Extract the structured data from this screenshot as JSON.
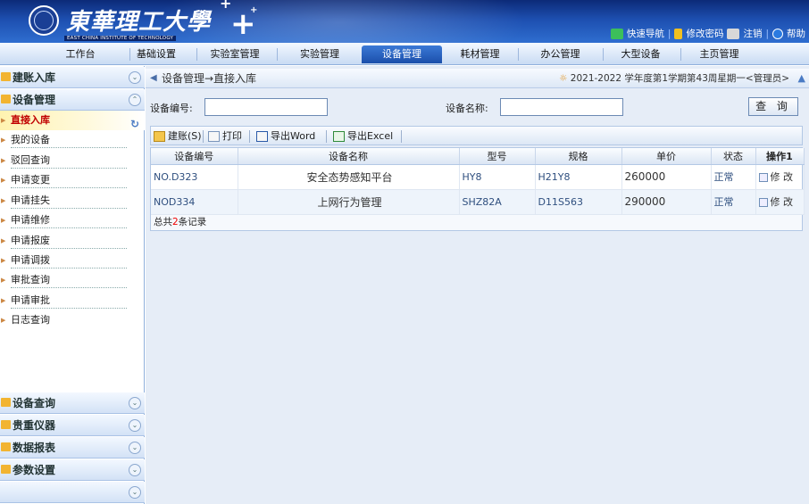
{
  "header": {
    "logo_cn": "東華理工大學",
    "logo_en": "EAST CHINA INSTITUTE OF TECHNOLOGY",
    "links": [
      {
        "icon": "quick-nav-icon",
        "label": "快速导航"
      },
      {
        "icon": "lock-icon",
        "label": "修改密码"
      },
      {
        "icon": "logout-icon",
        "label": "注销"
      },
      {
        "icon": "help-icon",
        "label": "帮助"
      }
    ]
  },
  "nav": {
    "tabs": [
      "工作台",
      "基础设置",
      "实验室管理",
      "实验管理",
      "设备管理",
      "耗材管理",
      "办公管理",
      "大型设备",
      "主页管理"
    ],
    "active": "设备管理"
  },
  "sidebar": {
    "top_sections": [
      {
        "label": "建账入库",
        "toggle": "⌄"
      },
      {
        "label": "设备管理",
        "toggle": "⌃"
      }
    ],
    "items": [
      "直接入库",
      "我的设备",
      "驳回查询",
      "申请变更",
      "申请挂失",
      "申请维修",
      "申请报废",
      "申请调拨",
      "审批查询",
      "申请审批",
      "日志查询"
    ],
    "active_item": "直接入库",
    "bottom_sections": [
      "设备查询",
      "贵重仪器",
      "数据报表",
      "参数设置",
      ""
    ]
  },
  "breadcrumb": {
    "path": "设备管理→直接入库",
    "info": "2021-2022 学年度第1学期第43周星期一<管理员>"
  },
  "search": {
    "code_label": "设备编号:",
    "code_value": "",
    "name_label": "设备名称:",
    "name_value": "",
    "query_button": "查 询"
  },
  "toolbar": {
    "create": "建账(S)",
    "print": "打印",
    "export_word": "导出Word",
    "export_excel": "导出Excel"
  },
  "table": {
    "headers": [
      "设备编号",
      "设备名称",
      "型号",
      "规格",
      "单价",
      "状态",
      "操作1"
    ],
    "rows": [
      {
        "code": "NO.D323",
        "name": "安全态势感知平台",
        "model": "HY8",
        "spec": "H21Y8",
        "price": "260000",
        "status": "正常",
        "op": "修 改"
      },
      {
        "code": "NOD334",
        "name": "上网行为管理",
        "model": "SHZ82A",
        "spec": "D11S563",
        "price": "290000",
        "status": "正常",
        "op": "修 改"
      }
    ],
    "total_prefix": "总共",
    "total_count": "2",
    "total_suffix": "条记录"
  }
}
